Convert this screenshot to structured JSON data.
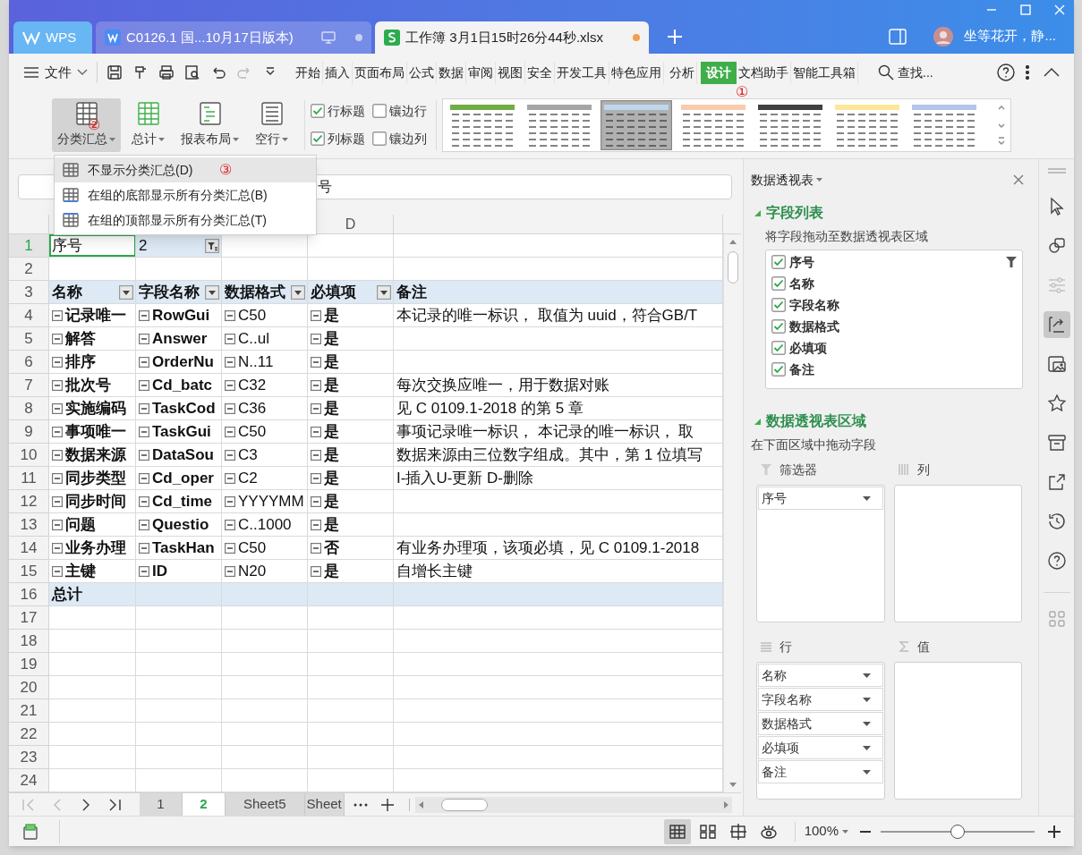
{
  "title_bar": {
    "tabs": [
      {
        "label": "WPS",
        "kind": "home",
        "selected": false
      },
      {
        "label": "C0126.1 国...10月17日版本)",
        "kind": "doc",
        "selected": false
      },
      {
        "label": "工作簿 3月1日15时26分44秒.xlsx",
        "kind": "sheet",
        "selected": true
      }
    ],
    "user": "坐等花开，静..."
  },
  "menu": {
    "file": "文件",
    "items": [
      {
        "label": "开始",
        "selected": false
      },
      {
        "label": "插入",
        "selected": false
      },
      {
        "label": "页面布局",
        "selected": false
      },
      {
        "label": "公式",
        "selected": false
      },
      {
        "label": "数据",
        "selected": false
      },
      {
        "label": "审阅",
        "selected": false
      },
      {
        "label": "视图",
        "selected": false
      },
      {
        "label": "安全",
        "selected": false
      },
      {
        "label": "开发工具",
        "selected": false
      },
      {
        "label": "特色应用",
        "selected": false
      },
      {
        "label": "分析",
        "selected": false
      },
      {
        "label": "设计",
        "selected": true,
        "annotation": "①"
      },
      {
        "label": "文档助手",
        "selected": false
      },
      {
        "label": "智能工具箱",
        "selected": false
      }
    ],
    "search": "查找..."
  },
  "ribbon": {
    "buttons": [
      {
        "label": "分类汇总",
        "kind": "subtotal",
        "selected": true,
        "annotation": "②"
      },
      {
        "label": "总计",
        "kind": "total",
        "selected": false
      },
      {
        "label": "报表布局",
        "kind": "layout",
        "selected": false
      },
      {
        "label": "空行",
        "kind": "blank",
        "selected": false
      }
    ],
    "options": [
      {
        "label": "行标题",
        "checked": true
      },
      {
        "label": "镶边行",
        "checked": false
      },
      {
        "label": "列标题",
        "checked": true
      },
      {
        "label": "镶边列",
        "checked": false
      }
    ],
    "styles": [
      {
        "color": "#70ad47",
        "selected": false
      },
      {
        "color": "#a5a5a5",
        "selected": false
      },
      {
        "color": "#bdd7ee",
        "selected": true
      },
      {
        "color": "#f8cbad",
        "selected": false
      },
      {
        "color": "#404040",
        "selected": false
      },
      {
        "color": "#ffe699",
        "selected": false
      },
      {
        "color": "#b4c6e7",
        "selected": false
      }
    ]
  },
  "subtotal_menu": {
    "items": [
      {
        "label": "不显示分类汇总(D)",
        "kind": "none",
        "selected": true,
        "annotation": "③"
      },
      {
        "label": "在组的底部显示所有分类汇总(B)",
        "kind": "bottom",
        "selected": false
      },
      {
        "label": "在组的顶部显示所有分类汇总(T)",
        "kind": "top",
        "selected": false
      }
    ]
  },
  "formula_bar": {
    "value": "号"
  },
  "sheet": {
    "column_header": "D",
    "rows": [
      {
        "number": "1",
        "kind": "filter",
        "cells": [
          "序号",
          "2"
        ]
      },
      {
        "number": "2",
        "kind": "empty"
      },
      {
        "number": "3",
        "kind": "header",
        "cells": [
          "名称",
          "字段名称",
          "数据格式",
          "必填项",
          "备注"
        ]
      },
      {
        "number": "4",
        "kind": "data",
        "cells": [
          "记录唯一",
          "RowGui",
          "C50",
          "是",
          "本记录的唯一标识， 取值为 uuid，符合GB/T"
        ]
      },
      {
        "number": "5",
        "kind": "data",
        "cells": [
          "解答",
          "Answer",
          "C..ul",
          "是"
        ]
      },
      {
        "number": "6",
        "kind": "data",
        "cells": [
          "排序",
          "OrderNu",
          "N..11",
          "是"
        ]
      },
      {
        "number": "7",
        "kind": "data",
        "cells": [
          "批次号",
          "Cd_batc",
          "C32",
          "是",
          "每次交换应唯一，用于数据对账"
        ]
      },
      {
        "number": "8",
        "kind": "data",
        "cells": [
          "实施编码",
          "TaskCod",
          "C36",
          "是",
          "见 C 0109.1-2018 的第 5 章"
        ]
      },
      {
        "number": "9",
        "kind": "data",
        "cells": [
          "事项唯一",
          "TaskGui",
          "C50",
          "是",
          "事项记录唯一标识， 本记录的唯一标识， 取"
        ]
      },
      {
        "number": "10",
        "kind": "data",
        "cells": [
          "数据来源",
          "DataSou",
          "C3",
          "是",
          "数据来源由三位数字组成。其中，第 1 位填写"
        ]
      },
      {
        "number": "11",
        "kind": "data",
        "cells": [
          "同步类型",
          "Cd_oper",
          "C2",
          "是",
          "I-插入U-更新 D-删除"
        ]
      },
      {
        "number": "12",
        "kind": "data",
        "cells": [
          "同步时间",
          "Cd_time",
          "YYYYMM",
          "是"
        ]
      },
      {
        "number": "13",
        "kind": "data",
        "cells": [
          "问题",
          "Questio",
          "C..1000",
          "是"
        ]
      },
      {
        "number": "14",
        "kind": "data",
        "cells": [
          "业务办理",
          "TaskHan",
          "C50",
          "否",
          "有业务办理项，该项必填，见 C 0109.1-2018"
        ]
      },
      {
        "number": "15",
        "kind": "data",
        "cells": [
          "主键",
          "ID",
          "N20",
          "是",
          "自增长主键"
        ]
      },
      {
        "number": "16",
        "kind": "total",
        "cells": [
          "总计"
        ]
      },
      {
        "number": "17",
        "kind": "empty"
      },
      {
        "number": "18",
        "kind": "empty"
      },
      {
        "number": "19",
        "kind": "empty"
      },
      {
        "number": "20",
        "kind": "empty"
      },
      {
        "number": "21",
        "kind": "empty"
      },
      {
        "number": "22",
        "kind": "empty"
      },
      {
        "number": "23",
        "kind": "empty"
      },
      {
        "number": "24",
        "kind": "empty"
      }
    ]
  },
  "sheet_tabs": [
    {
      "label": "1",
      "selected": false
    },
    {
      "label": "2",
      "selected": true
    },
    {
      "label": "Sheet5",
      "selected": false
    },
    {
      "label": "Sheet",
      "selected": false
    }
  ],
  "pivot_pane": {
    "title": "数据透视表",
    "field_list": {
      "heading": "字段列表",
      "hint": "将字段拖动至数据透视表区域",
      "fields": [
        {
          "label": "序号",
          "checked": true,
          "filtered": true
        },
        {
          "label": "名称",
          "checked": true,
          "filtered": false
        },
        {
          "label": "字段名称",
          "checked": true,
          "filtered": false
        },
        {
          "label": "数据格式",
          "checked": true,
          "filtered": false
        },
        {
          "label": "必填项",
          "checked": true,
          "filtered": false
        },
        {
          "label": "备注",
          "checked": true,
          "filtered": false
        }
      ]
    },
    "areas": {
      "heading": "数据透视表区域",
      "hint": "在下面区域中拖动字段",
      "zones": [
        {
          "label": "筛选器",
          "kind": "filter",
          "fields": [
            "序号"
          ]
        },
        {
          "label": "列",
          "kind": "column"
        },
        {
          "label": "行",
          "kind": "row",
          "fields": [
            "名称",
            "字段名称",
            "数据格式",
            "必填项",
            "备注"
          ]
        },
        {
          "label": "值",
          "kind": "value"
        }
      ]
    }
  },
  "tools": [
    {
      "kind": "pointer",
      "selected": false,
      "disabled": false
    },
    {
      "kind": "shapes",
      "selected": false,
      "disabled": false
    },
    {
      "kind": "sliders",
      "selected": false,
      "disabled": true
    },
    {
      "kind": "pivot",
      "selected": true,
      "disabled": false
    },
    {
      "kind": "image",
      "selected": false,
      "disabled": false
    },
    {
      "kind": "star",
      "selected": false,
      "disabled": false
    },
    {
      "kind": "archive",
      "selected": false,
      "disabled": false
    },
    {
      "kind": "share",
      "selected": false,
      "disabled": false
    },
    {
      "kind": "history",
      "selected": false,
      "disabled": false
    },
    {
      "kind": "help",
      "selected": false,
      "disabled": false
    },
    {
      "kind": "apps",
      "selected": false,
      "disabled": false
    }
  ],
  "status_bar": {
    "views": [
      {
        "kind": "normal",
        "selected": true
      },
      {
        "kind": "page_break",
        "selected": false
      },
      {
        "kind": "page_layout",
        "selected": false
      },
      {
        "kind": "reading",
        "selected": false
      }
    ],
    "zoom": {
      "reading": "100%",
      "level": 0.5
    }
  }
}
